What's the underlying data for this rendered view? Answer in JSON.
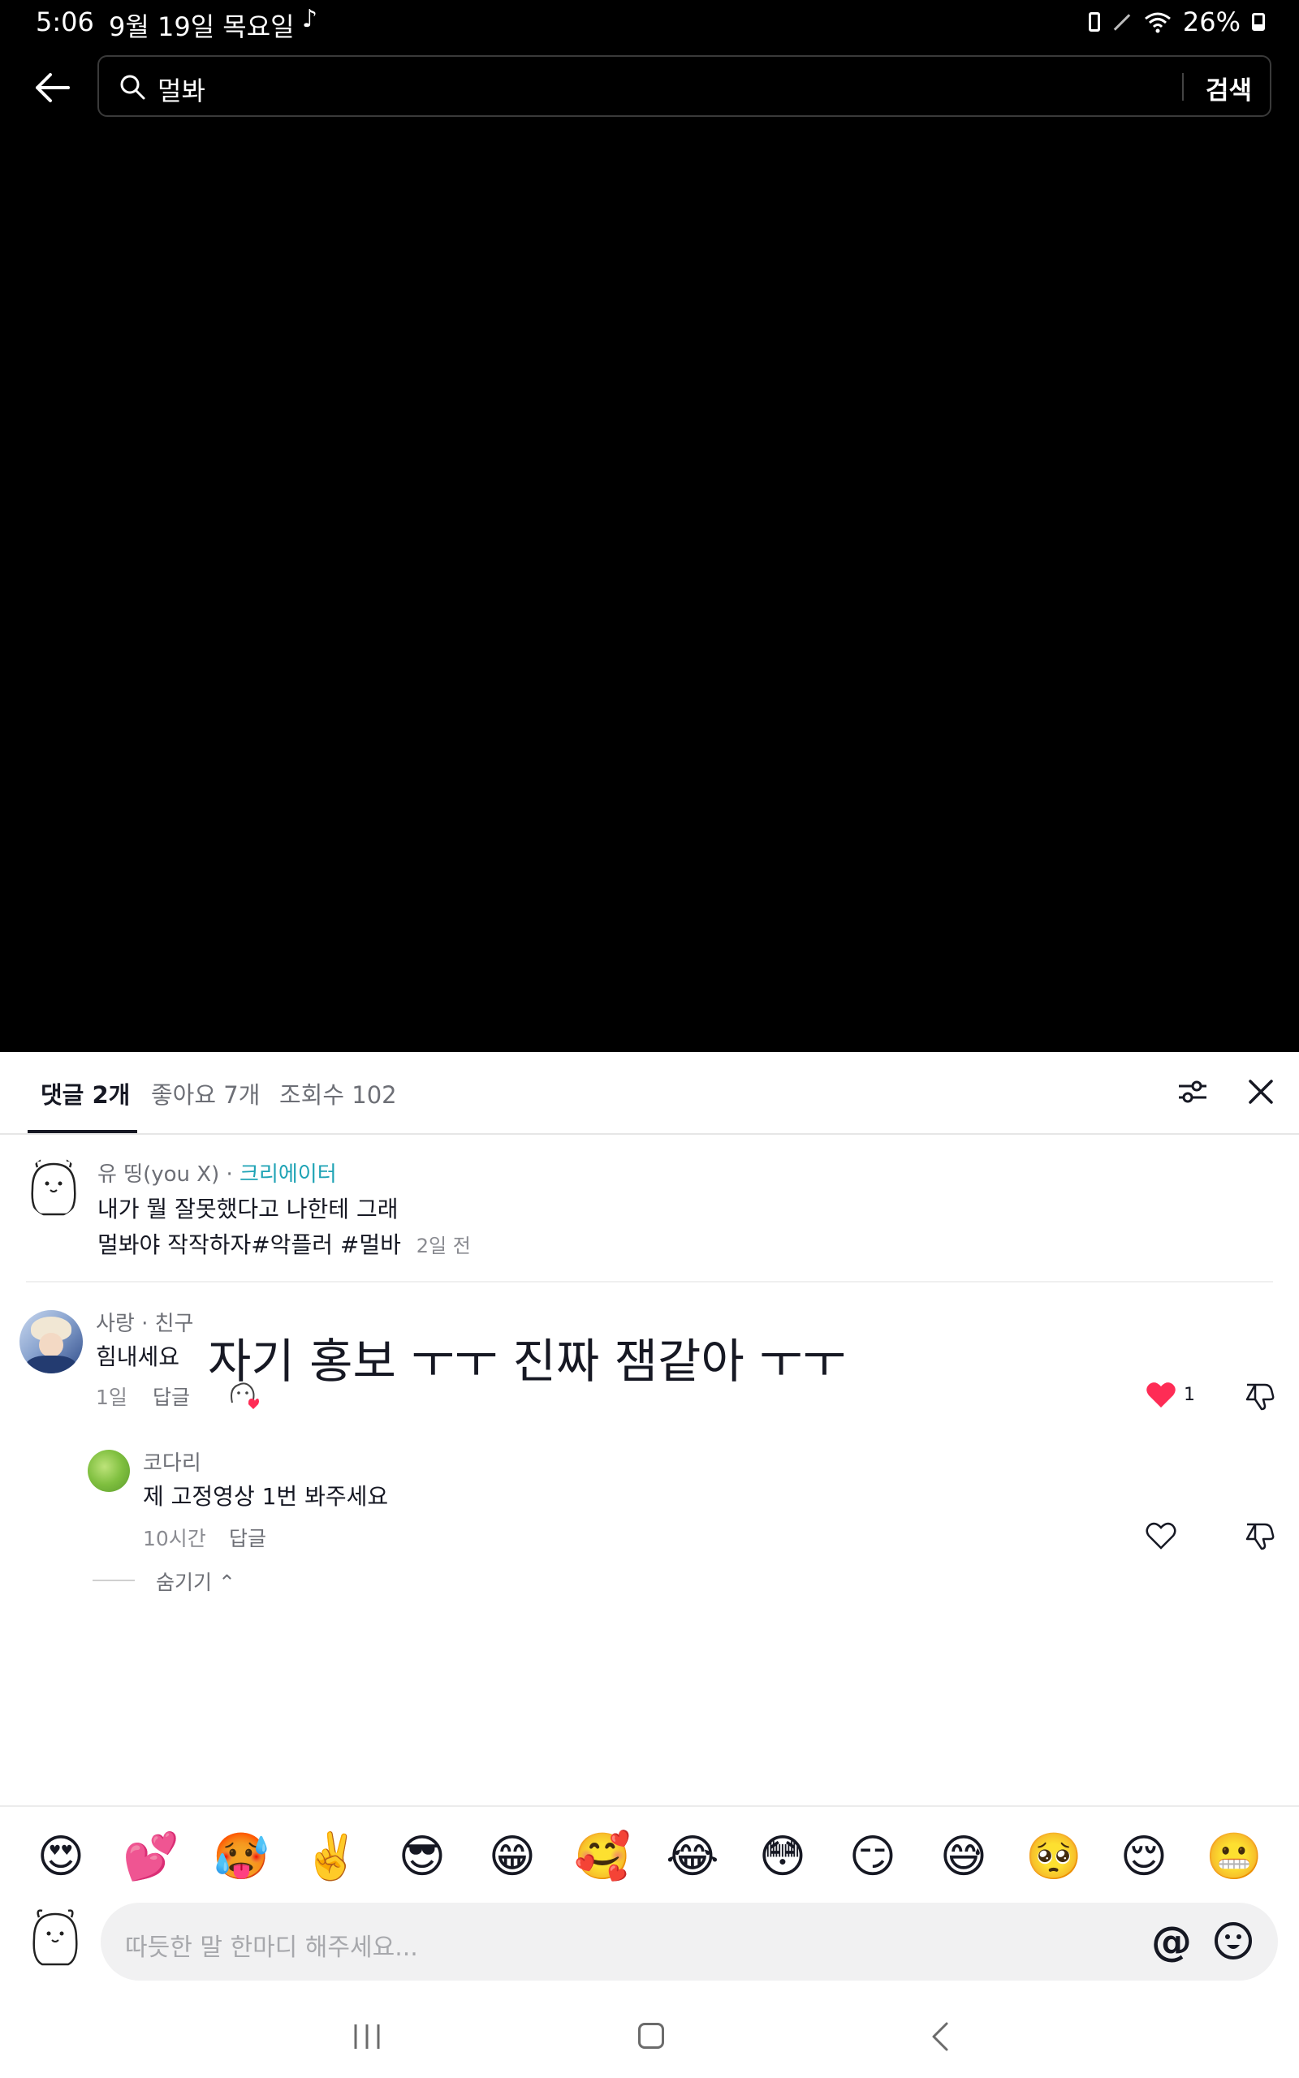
{
  "status_bar": {
    "time": "5:06",
    "date": "9월 19일 목요일",
    "battery": "26%"
  },
  "search": {
    "query": "멀봐",
    "button_label": "검색"
  },
  "tabs": [
    {
      "label": "댓글 2개",
      "active": true
    },
    {
      "label": "좋아요 7개",
      "active": false
    },
    {
      "label": "조회수 102",
      "active": false
    }
  ],
  "caption": {
    "user": "유 띵(you X) · ",
    "creator_badge": "크리에이터",
    "line1": "내가 뭘 잘못했다고 나한테 그래",
    "line2": "멀봐야 작작하자#악플러 #멀바",
    "time": "2일 전"
  },
  "comments": [
    {
      "user": "사랑 · 친구",
      "text": "힘내세요",
      "overlay_text": "자기 홍보 ㅜㅜ 진짜 잼같아 ㅜㅜ",
      "time": "1일",
      "reply_label": "답글",
      "likes": "1",
      "liked": true,
      "replies": [
        {
          "user": "코다리",
          "text": "제 고정영상 1번 봐주세요",
          "time": "10시간",
          "reply_label": "답글"
        }
      ],
      "hide_label": "숨기기"
    }
  ],
  "emojis": [
    "😍",
    "💕",
    "🥵",
    "✌️",
    "😎",
    "😁",
    "🥰",
    "😂",
    "😳",
    "😏",
    "😅",
    "🥺",
    "😌",
    "😬"
  ],
  "input": {
    "placeholder": "따듯한 말 한마디 해주세요..."
  },
  "colors": {
    "creator": "#1fa3b5",
    "like_red": "#fe2c55",
    "video_bg": "#000000"
  },
  "icons": {
    "back": "arrow-left-icon",
    "search": "search-icon",
    "filter": "sliders-icon",
    "close": "close-icon",
    "like": "heart-icon",
    "dislike": "thumbs-down-icon",
    "mention": "at-icon",
    "emoji": "smile-icon"
  }
}
